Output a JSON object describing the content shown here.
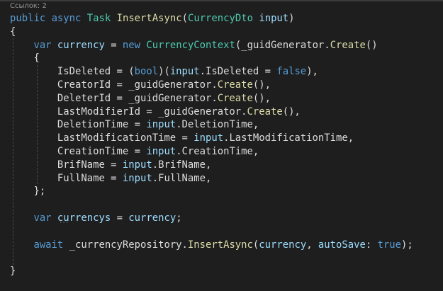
{
  "code_lens": "Ссылок: 2",
  "colors": {
    "background": "#1e1e1e",
    "keyword": "#569cd6",
    "type": "#4ec9b0",
    "method": "#dcdcaa",
    "local": "#9cdcfe",
    "text": "#dcdcdc"
  },
  "lines": [
    [
      [
        "public",
        "kw"
      ],
      [
        " ",
        "pn"
      ],
      [
        "async",
        "kw"
      ],
      [
        " ",
        "pn"
      ],
      [
        "Task",
        "ty"
      ],
      [
        " ",
        "pn"
      ],
      [
        "InsertAsync",
        "fn"
      ],
      [
        "(",
        "pn"
      ],
      [
        "CurrencyDto",
        "ty"
      ],
      [
        " ",
        "pn"
      ],
      [
        "input",
        "lv"
      ],
      [
        ")",
        "pn"
      ]
    ],
    [
      [
        "{",
        "pn"
      ]
    ],
    [
      [
        "    ",
        "pn"
      ],
      [
        "var",
        "kw"
      ],
      [
        " ",
        "pn"
      ],
      [
        "currency",
        "lv"
      ],
      [
        " = ",
        "pn"
      ],
      [
        "new",
        "kw"
      ],
      [
        " ",
        "pn"
      ],
      [
        "CurrencyContext",
        "ty"
      ],
      [
        "(",
        "pn"
      ],
      [
        "_guidGenerator",
        "pr"
      ],
      [
        ".",
        "pn"
      ],
      [
        "Create",
        "fn"
      ],
      [
        "()",
        "pn"
      ]
    ],
    [
      [
        "    {",
        "pn"
      ]
    ],
    [
      [
        "        IsDeleted = (",
        "pr"
      ],
      [
        "bool",
        "kw"
      ],
      [
        ")(",
        "pn"
      ],
      [
        "input",
        "lv"
      ],
      [
        ".IsDeleted = ",
        "pr"
      ],
      [
        "false",
        "kw"
      ],
      [
        "),",
        "pn"
      ]
    ],
    [
      [
        "        CreatorId = _guidGenerator.",
        "pr"
      ],
      [
        "Create",
        "fn"
      ],
      [
        "(),",
        "pn"
      ]
    ],
    [
      [
        "        DeleterId = _guidGenerator.",
        "pr"
      ],
      [
        "Create",
        "fn"
      ],
      [
        "(),",
        "pn"
      ]
    ],
    [
      [
        "        LastModifierId = _guidGenerator.",
        "pr"
      ],
      [
        "Create",
        "fn"
      ],
      [
        "(),",
        "pn"
      ]
    ],
    [
      [
        "        DeletionTime = ",
        "pr"
      ],
      [
        "input",
        "lv"
      ],
      [
        ".DeletionTime,",
        "pr"
      ]
    ],
    [
      [
        "        LastModificationTime = ",
        "pr"
      ],
      [
        "input",
        "lv"
      ],
      [
        ".LastModificationTime,",
        "pr"
      ]
    ],
    [
      [
        "        CreationTime = ",
        "pr"
      ],
      [
        "input",
        "lv"
      ],
      [
        ".CreationTime,",
        "pr"
      ]
    ],
    [
      [
        "        BrifName = ",
        "pr"
      ],
      [
        "input",
        "lv"
      ],
      [
        ".BrifName,",
        "pr"
      ]
    ],
    [
      [
        "        FullName = ",
        "pr"
      ],
      [
        "input",
        "lv"
      ],
      [
        ".FullName,",
        "pr"
      ]
    ],
    [
      [
        "    };",
        "pn"
      ]
    ],
    [],
    [
      [
        "    ",
        "pn"
      ],
      [
        "var",
        "kw"
      ],
      [
        " ",
        "pn"
      ],
      [
        "currencys",
        "lv"
      ],
      [
        " = ",
        "pn"
      ],
      [
        "currency",
        "lv"
      ],
      [
        ";",
        "pn"
      ]
    ],
    [],
    [
      [
        "    ",
        "pn"
      ],
      [
        "await",
        "kw"
      ],
      [
        " _currencyRepository.",
        "pr"
      ],
      [
        "InsertAsync",
        "fn"
      ],
      [
        "(",
        "pn"
      ],
      [
        "currency",
        "lv"
      ],
      [
        ", ",
        "pn"
      ],
      [
        "autoSave",
        "lv"
      ],
      [
        ": ",
        "pn"
      ],
      [
        "true",
        "kw"
      ],
      [
        ");",
        "pn"
      ]
    ],
    [],
    [
      [
        "}",
        "pn"
      ]
    ]
  ]
}
